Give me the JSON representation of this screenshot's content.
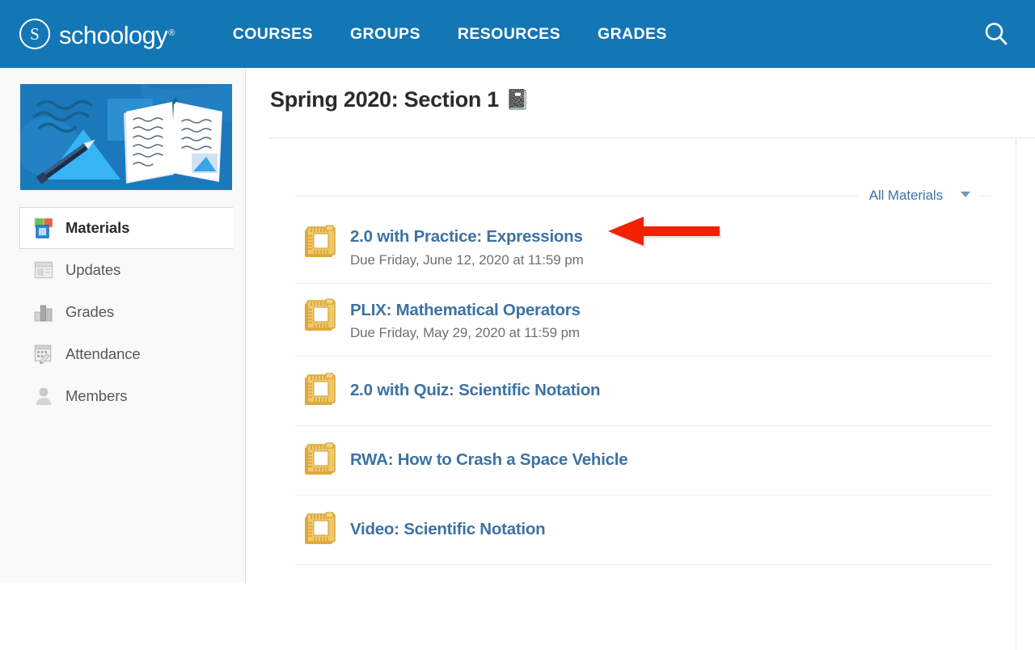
{
  "header": {
    "brand_letter": "S",
    "brand_name": "schoology",
    "brand_tm": "®",
    "nav": [
      {
        "label": "COURSES",
        "name": "courses"
      },
      {
        "label": "GROUPS",
        "name": "groups"
      },
      {
        "label": "RESOURCES",
        "name": "resources"
      },
      {
        "label": "GRADES",
        "name": "grades"
      }
    ],
    "search_icon": "search-icon",
    "background_color": "#1376b5"
  },
  "sidebar": {
    "course_image_alt": "course-thumbnail-book-and-pencil",
    "items": [
      {
        "label": "Materials",
        "icon": "stacked-squares-icon",
        "active": true
      },
      {
        "label": "Updates",
        "icon": "window-panel-icon",
        "active": false
      },
      {
        "label": "Grades",
        "icon": "bar-chart-icon",
        "active": false
      },
      {
        "label": "Attendance",
        "icon": "checklist-pencil-icon",
        "active": false
      },
      {
        "label": "Members",
        "icon": "person-icon",
        "active": false
      }
    ]
  },
  "main": {
    "page_title": "Spring 2020: Section 1",
    "page_title_emoji": "📓",
    "filter": {
      "label": "All Materials",
      "caret_icon": "chevron-down-icon"
    },
    "materials": [
      {
        "title": "2.0 with Practice: Expressions",
        "due": "Due Friday, June 12, 2020 at 11:59 pm",
        "icon": "assignment-ruler-icon"
      },
      {
        "title": "PLIX: Mathematical Operators",
        "due": "Due Friday, May 29, 2020 at 11:59 pm",
        "icon": "assignment-ruler-icon"
      },
      {
        "title": "2.0 with Quiz: Scientific Notation",
        "due": "",
        "icon": "assignment-ruler-icon"
      },
      {
        "title": "RWA: How to Crash a Space Vehicle",
        "due": "",
        "icon": "assignment-ruler-icon"
      },
      {
        "title": "Video: Scientific Notation",
        "due": "",
        "icon": "assignment-ruler-icon"
      }
    ]
  },
  "annotation": {
    "arrow": "red-left-arrow",
    "color": "#f32100"
  }
}
